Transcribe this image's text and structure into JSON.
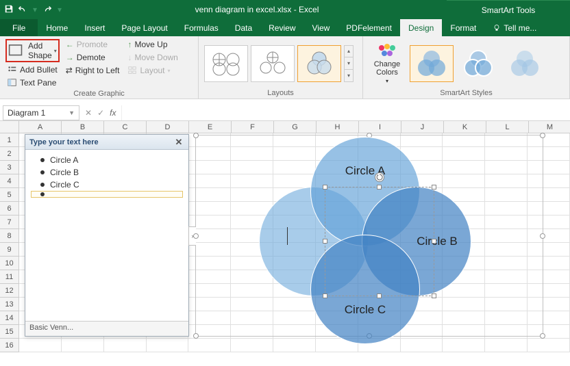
{
  "titlebar": {
    "filename": "venn diagram in excel.xlsx - Excel",
    "context_tab": "SmartArt Tools"
  },
  "tabs": {
    "file": "File",
    "home": "Home",
    "insert": "Insert",
    "page_layout": "Page Layout",
    "formulas": "Formulas",
    "data": "Data",
    "review": "Review",
    "view": "View",
    "pdfelement": "PDFelement",
    "design": "Design",
    "format": "Format",
    "tellme": "Tell me..."
  },
  "ribbon": {
    "create_graphic": {
      "label": "Create Graphic",
      "add_shape": "Add Shape",
      "add_bullet": "Add Bullet",
      "text_pane": "Text Pane",
      "promote": "Promote",
      "demote": "Demote",
      "right_to_left": "Right to Left",
      "move_up": "Move Up",
      "move_down": "Move Down",
      "layout": "Layout"
    },
    "layouts": {
      "label": "Layouts"
    },
    "change_colors": {
      "label": "Change Colors"
    },
    "styles": {
      "label": "SmartArt Styles"
    }
  },
  "namebox": "Diagram 1",
  "fx_label": "fx",
  "columns": [
    "A",
    "B",
    "C",
    "D",
    "E",
    "F",
    "G",
    "H",
    "I",
    "J",
    "K",
    "L",
    "M"
  ],
  "rows": [
    "1",
    "2",
    "3",
    "4",
    "5",
    "6",
    "7",
    "8",
    "9",
    "10",
    "11",
    "12",
    "13",
    "14",
    "15",
    "16"
  ],
  "text_pane": {
    "header": "Type your text here",
    "items": [
      "Circle A",
      "Circle B",
      "Circle C",
      ""
    ],
    "footer": "Basic Venn..."
  },
  "venn": {
    "a": "Circle A",
    "b": "Circle B",
    "c": "Circle C"
  }
}
